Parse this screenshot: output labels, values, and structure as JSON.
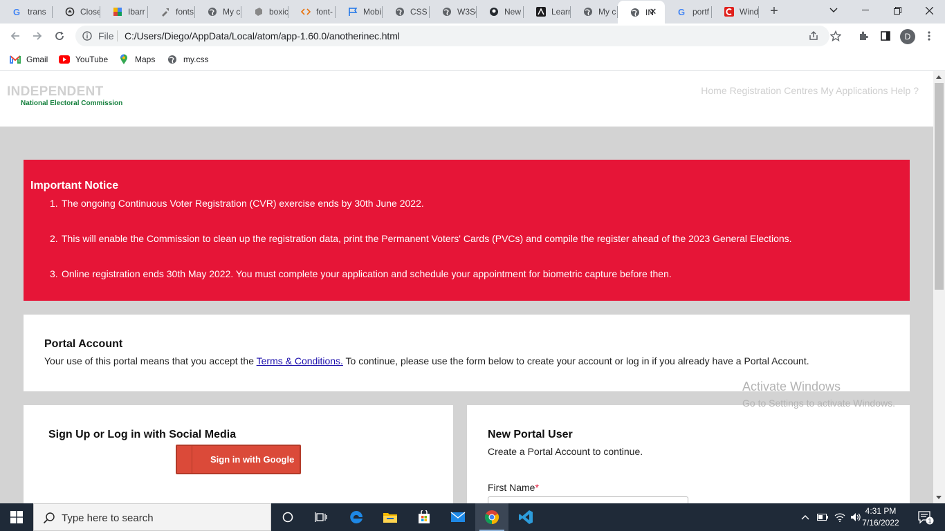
{
  "browser": {
    "tabs": [
      {
        "title": "trans",
        "icon": "google-icon"
      },
      {
        "title": "Close",
        "icon": "recycle-icon"
      },
      {
        "title": "Ibarr",
        "icon": "puzzle-icon"
      },
      {
        "title": "fonts",
        "icon": "tool-icon"
      },
      {
        "title": "My c",
        "icon": "globe-icon"
      },
      {
        "title": "boxic",
        "icon": "boxicons-icon"
      },
      {
        "title": "font-",
        "icon": "code-icon"
      },
      {
        "title": "Mobi",
        "icon": "flag-icon"
      },
      {
        "title": "CSS t",
        "icon": "globe-icon"
      },
      {
        "title": "W3Sc",
        "icon": "globe-icon"
      },
      {
        "title": "New",
        "icon": "github-icon"
      },
      {
        "title": "Learn",
        "icon": "learn-icon"
      },
      {
        "title": "My c",
        "icon": "globe-icon"
      },
      {
        "title": "IN",
        "icon": "globe-icon",
        "active": true
      },
      {
        "title": "portf",
        "icon": "google-icon"
      },
      {
        "title": "Wind",
        "icon": "c-icon"
      }
    ],
    "new_tab": "+",
    "address": {
      "scheme_label": "File",
      "url": "C:/Users/Diego/AppData/Local/atom/app-1.60.0/anotherinec.html"
    },
    "profile_initial": "D",
    "bookmarks": [
      {
        "label": "Gmail",
        "icon": "gmail-icon"
      },
      {
        "label": "YouTube",
        "icon": "youtube-icon"
      },
      {
        "label": "Maps",
        "icon": "maps-icon"
      },
      {
        "label": "my.css",
        "icon": "globe-icon"
      }
    ]
  },
  "site": {
    "logo_main": "INDEPENDENT",
    "logo_sub": "National Electoral Commission",
    "nav": [
      "Home",
      "Registration Centres",
      "My Applications",
      "Help ?"
    ]
  },
  "notice": {
    "title": "Important Notice",
    "items": [
      {
        "num": "1.",
        "text": "The ongoing Continuous Voter Registration (CVR) exercise ends by 30th June 2022."
      },
      {
        "num": "2.",
        "text": "This will enable the Commission to clean up the registration data, print the Permanent Voters' Cards (PVCs) and compile the register ahead of the 2023 General Elections."
      },
      {
        "num": "3.",
        "text": "Online registration ends 30th May 2022. You must complete your application and schedule your appointment for biometric capture before then."
      }
    ]
  },
  "portal": {
    "title": "Portal Account",
    "text_before": "Your use of this portal means that you accept the ",
    "terms_link": "Terms & Conditions.",
    "text_after": " To continue, please use the form below to create your account or log in if you already have a Portal Account."
  },
  "social": {
    "title": "Sign Up or Log in with Social Media",
    "google_button": "Sign in with Google"
  },
  "new_user": {
    "title": "New Portal User",
    "subtitle": "Create a Portal Account to continue.",
    "first_name_label": "First Name",
    "required_mark": "*"
  },
  "watermark": {
    "line1": "Activate Windows",
    "line2": "Go to Settings to activate Windows."
  },
  "taskbar": {
    "search_placeholder": "Type here to search",
    "time": "4:31 PM",
    "date": "7/16/2022",
    "notification_count": "1"
  },
  "colors": {
    "notice_bg": "#e61537",
    "google_btn": "#db4a39",
    "logo_sub": "#15803d",
    "taskbar": "#1f2a38"
  }
}
